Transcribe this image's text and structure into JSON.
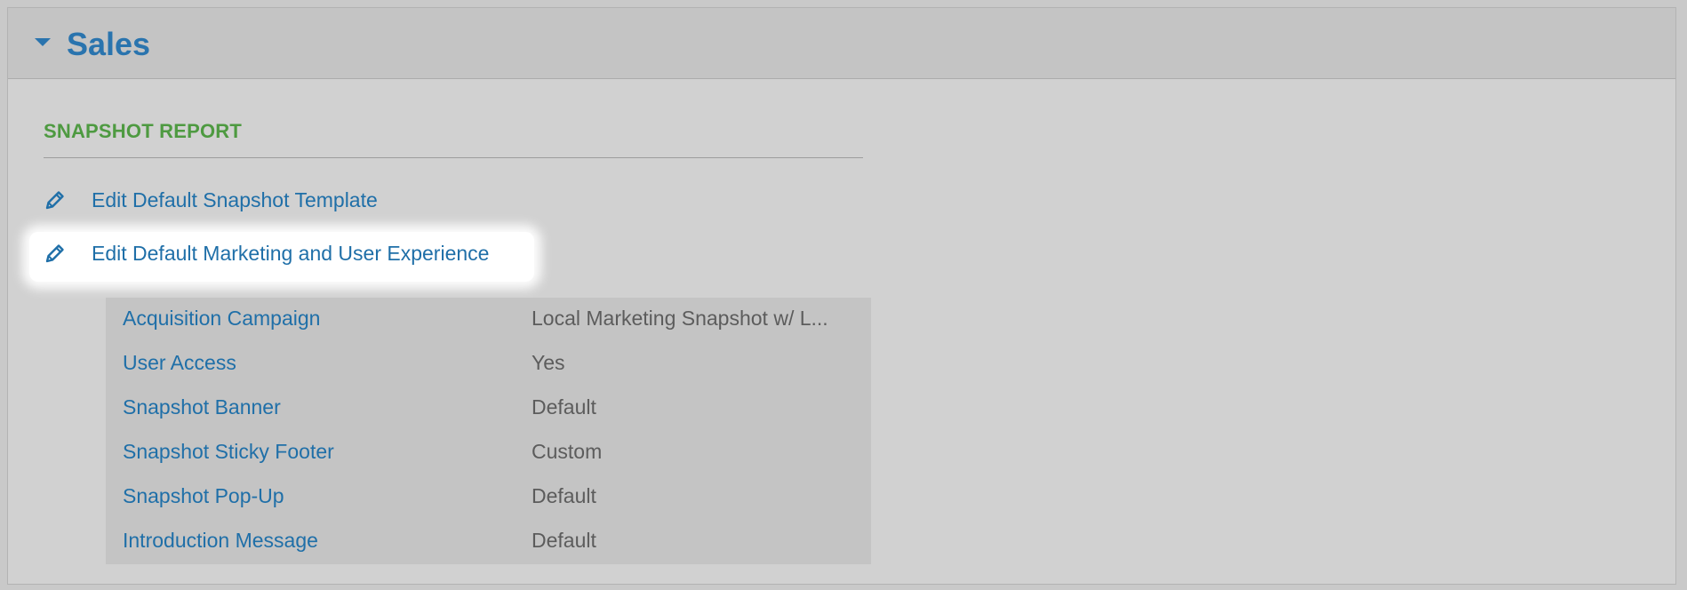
{
  "panel": {
    "title": "Sales"
  },
  "section": {
    "heading": "SNAPSHOT REPORT"
  },
  "actions": [
    {
      "label": "Edit Default Snapshot Template",
      "icon": "pencil-icon"
    },
    {
      "label": "Edit Default Marketing and User Experience",
      "icon": "pencil-icon"
    }
  ],
  "details": [
    {
      "key": "Acquisition Campaign",
      "value": "Local Marketing Snapshot w/ L..."
    },
    {
      "key": "User Access",
      "value": "Yes"
    },
    {
      "key": "Snapshot Banner",
      "value": "Default"
    },
    {
      "key": "Snapshot Sticky Footer",
      "value": "Custom"
    },
    {
      "key": "Snapshot Pop-Up",
      "value": "Default"
    },
    {
      "key": "Introduction Message",
      "value": "Default"
    }
  ],
  "colors": {
    "link": "#1f6fa8",
    "heading_green": "#4e9a41",
    "value_text": "#5c5c5c",
    "panel_bg": "#d1d1d1"
  }
}
